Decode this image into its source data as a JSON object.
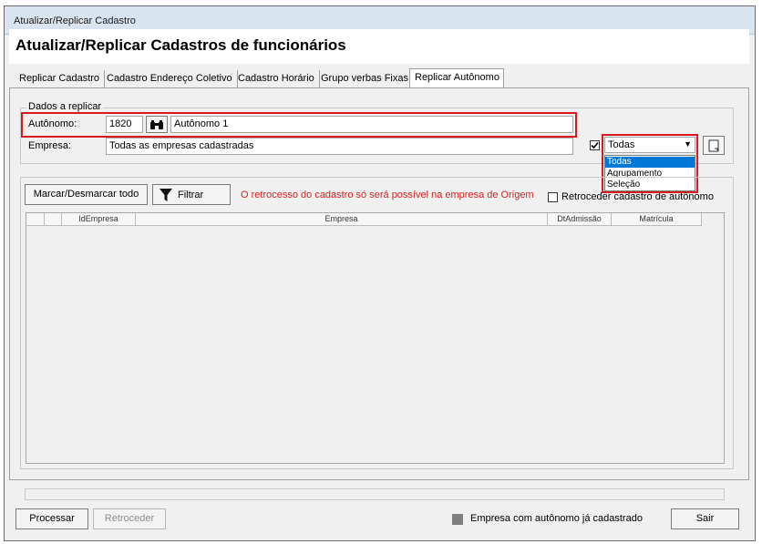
{
  "window": {
    "title": "Atualizar/Replicar Cadastro",
    "page_title": "Atualizar/Replicar Cadastros de funcionários"
  },
  "tabs": [
    {
      "label": "Replicar Cadastro"
    },
    {
      "label": "Cadastro Endereço Coletivo"
    },
    {
      "label": "Cadastro Horário"
    },
    {
      "label": "Grupo verbas Fixas"
    },
    {
      "label": "Replicar Autônomo"
    }
  ],
  "dados": {
    "group_label": "Dados a replicar",
    "autonomo_label": "Autônomo:",
    "autonomo_code": "1820",
    "autonomo_name": "Autônomo 1",
    "empresa_label": "Empresa:",
    "empresa_value": "Todas as empresas cadastradas",
    "filter_select": {
      "selected": "Todas",
      "options": [
        "Todas",
        "Agrupamento",
        "Seleção"
      ]
    }
  },
  "actions": {
    "mark_all": "Marcar/Desmarcar todo",
    "filter": "Filtrar",
    "warning": "O retrocesso do cadastro só será possível na empresa de Origem",
    "retroceder_check_label": "Retroceder cadastro de autônomo"
  },
  "grid": {
    "columns": [
      "IdEmpresa",
      "Empresa",
      "DtAdmissão",
      "Matrícula"
    ]
  },
  "footer": {
    "processar": "Processar",
    "retroceder": "Retroceder",
    "legend_text": "Empresa com autônomo já cadastrado",
    "sair": "Sair"
  },
  "colors": {
    "highlight_red": "#d9191f",
    "warning_text": "#d42020",
    "legend_swatch": "#7f7f7f",
    "dropdown_selected": "#0078d7"
  }
}
